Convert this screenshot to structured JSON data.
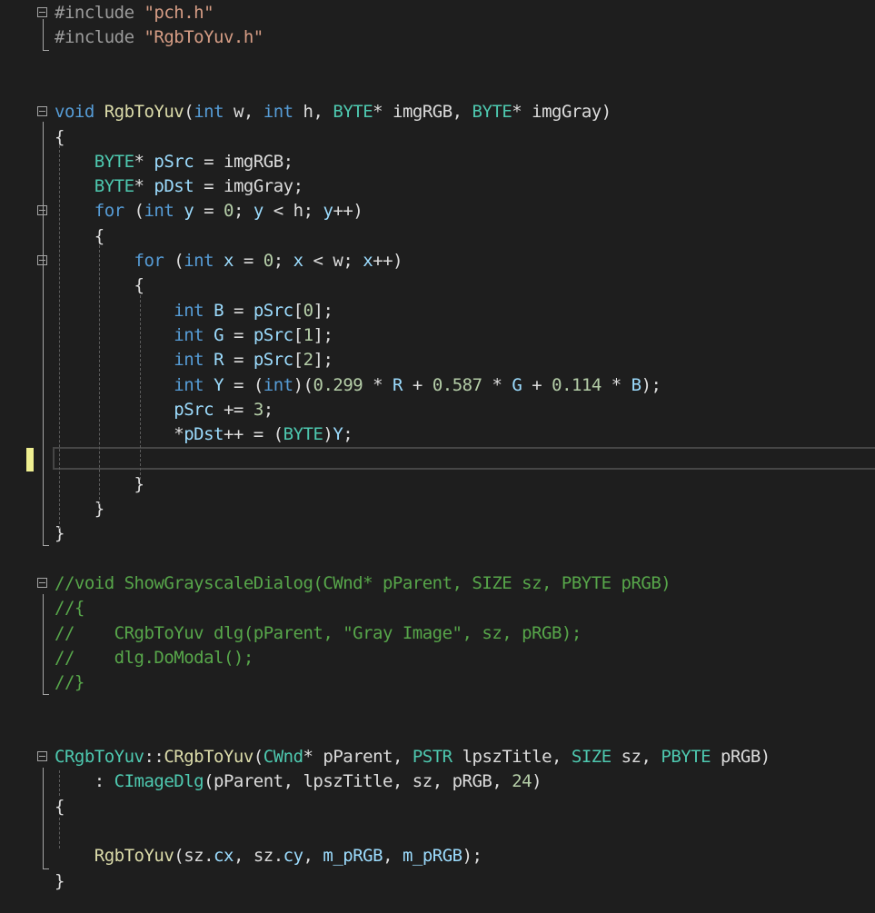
{
  "colors": {
    "background": "#1e1e1e",
    "keyword": "#569cd6",
    "type": "#4ec9b0",
    "string": "#d69d85",
    "comment": "#57a64a",
    "function": "#dcdcaa",
    "variable": "#9cdcfe",
    "number": "#b5cea8",
    "plain": "#dcdcdc",
    "preprocessor": "#9b9b9b",
    "changed_marker": "#efef91"
  },
  "code_lines": [
    {
      "row": 0,
      "tokens": [
        [
          "pp",
          "#include "
        ],
        [
          "str",
          "\"pch.h\""
        ]
      ]
    },
    {
      "row": 1,
      "tokens": [
        [
          "pp",
          "#include "
        ],
        [
          "str",
          "\"RgbToYuv.h\""
        ]
      ]
    },
    {
      "row": 2,
      "tokens": []
    },
    {
      "row": 3,
      "tokens": []
    },
    {
      "row": 4,
      "tokens": [
        [
          "kw",
          "void"
        ],
        [
          "p",
          " "
        ],
        [
          "fn",
          "RgbToYuv"
        ],
        [
          "p",
          "("
        ],
        [
          "kw",
          "int"
        ],
        [
          "p",
          " w, "
        ],
        [
          "kw",
          "int"
        ],
        [
          "p",
          " h, "
        ],
        [
          "ty",
          "BYTE"
        ],
        [
          "p",
          "* imgRGB, "
        ],
        [
          "ty",
          "BYTE"
        ],
        [
          "p",
          "* imgGray)"
        ]
      ]
    },
    {
      "row": 5,
      "tokens": [
        [
          "p",
          "{"
        ]
      ]
    },
    {
      "row": 6,
      "tokens": [
        [
          "p",
          "    "
        ],
        [
          "ty",
          "BYTE"
        ],
        [
          "p",
          "* "
        ],
        [
          "var",
          "pSrc"
        ],
        [
          "p",
          " = imgRGB;"
        ]
      ]
    },
    {
      "row": 7,
      "tokens": [
        [
          "p",
          "    "
        ],
        [
          "ty",
          "BYTE"
        ],
        [
          "p",
          "* "
        ],
        [
          "var",
          "pDst"
        ],
        [
          "p",
          " = imgGray;"
        ]
      ]
    },
    {
      "row": 8,
      "tokens": [
        [
          "p",
          "    "
        ],
        [
          "kw",
          "for"
        ],
        [
          "p",
          " ("
        ],
        [
          "kw",
          "int"
        ],
        [
          "p",
          " "
        ],
        [
          "var",
          "y"
        ],
        [
          "p",
          " = "
        ],
        [
          "num",
          "0"
        ],
        [
          "p",
          "; "
        ],
        [
          "var",
          "y"
        ],
        [
          "p",
          " < h; "
        ],
        [
          "var",
          "y"
        ],
        [
          "p",
          "++)"
        ]
      ]
    },
    {
      "row": 9,
      "tokens": [
        [
          "p",
          "    {"
        ]
      ]
    },
    {
      "row": 10,
      "tokens": [
        [
          "p",
          "        "
        ],
        [
          "kw",
          "for"
        ],
        [
          "p",
          " ("
        ],
        [
          "kw",
          "int"
        ],
        [
          "p",
          " "
        ],
        [
          "var",
          "x"
        ],
        [
          "p",
          " = "
        ],
        [
          "num",
          "0"
        ],
        [
          "p",
          "; "
        ],
        [
          "var",
          "x"
        ],
        [
          "p",
          " < w; "
        ],
        [
          "var",
          "x"
        ],
        [
          "p",
          "++)"
        ]
      ]
    },
    {
      "row": 11,
      "tokens": [
        [
          "p",
          "        {"
        ]
      ]
    },
    {
      "row": 12,
      "tokens": [
        [
          "p",
          "            "
        ],
        [
          "kw",
          "int"
        ],
        [
          "p",
          " "
        ],
        [
          "var",
          "B"
        ],
        [
          "p",
          " = "
        ],
        [
          "var",
          "pSrc"
        ],
        [
          "p",
          "["
        ],
        [
          "num",
          "0"
        ],
        [
          "p",
          "];"
        ]
      ]
    },
    {
      "row": 13,
      "tokens": [
        [
          "p",
          "            "
        ],
        [
          "kw",
          "int"
        ],
        [
          "p",
          " "
        ],
        [
          "var",
          "G"
        ],
        [
          "p",
          " = "
        ],
        [
          "var",
          "pSrc"
        ],
        [
          "p",
          "["
        ],
        [
          "num",
          "1"
        ],
        [
          "p",
          "];"
        ]
      ]
    },
    {
      "row": 14,
      "tokens": [
        [
          "p",
          "            "
        ],
        [
          "kw",
          "int"
        ],
        [
          "p",
          " "
        ],
        [
          "var",
          "R"
        ],
        [
          "p",
          " = "
        ],
        [
          "var",
          "pSrc"
        ],
        [
          "p",
          "["
        ],
        [
          "num",
          "2"
        ],
        [
          "p",
          "];"
        ]
      ]
    },
    {
      "row": 15,
      "tokens": [
        [
          "p",
          "            "
        ],
        [
          "kw",
          "int"
        ],
        [
          "p",
          " "
        ],
        [
          "var",
          "Y"
        ],
        [
          "p",
          " = ("
        ],
        [
          "kw",
          "int"
        ],
        [
          "p",
          ")("
        ],
        [
          "num",
          "0.299"
        ],
        [
          "p",
          " * "
        ],
        [
          "var",
          "R"
        ],
        [
          "p",
          " + "
        ],
        [
          "num",
          "0.587"
        ],
        [
          "p",
          " * "
        ],
        [
          "var",
          "G"
        ],
        [
          "p",
          " + "
        ],
        [
          "num",
          "0.114"
        ],
        [
          "p",
          " * "
        ],
        [
          "var",
          "B"
        ],
        [
          "p",
          ");"
        ]
      ]
    },
    {
      "row": 16,
      "tokens": [
        [
          "p",
          "            "
        ],
        [
          "var",
          "pSrc"
        ],
        [
          "p",
          " += "
        ],
        [
          "num",
          "3"
        ],
        [
          "p",
          ";"
        ]
      ]
    },
    {
      "row": 17,
      "tokens": [
        [
          "p",
          "            *"
        ],
        [
          "var",
          "pDst"
        ],
        [
          "p",
          "++ = ("
        ],
        [
          "ty",
          "BYTE"
        ],
        [
          "p",
          ")"
        ],
        [
          "var",
          "Y"
        ],
        [
          "p",
          ";"
        ]
      ]
    },
    {
      "row": 18,
      "tokens": []
    },
    {
      "row": 19,
      "tokens": [
        [
          "p",
          "        }"
        ]
      ]
    },
    {
      "row": 20,
      "tokens": [
        [
          "p",
          "    }"
        ]
      ]
    },
    {
      "row": 21,
      "tokens": [
        [
          "p",
          "}"
        ]
      ]
    },
    {
      "row": 22,
      "tokens": []
    },
    {
      "row": 23,
      "tokens": [
        [
          "cm",
          "//void ShowGrayscaleDialog(CWnd* pParent, SIZE sz, PBYTE pRGB)"
        ]
      ]
    },
    {
      "row": 24,
      "tokens": [
        [
          "cm",
          "//{"
        ]
      ]
    },
    {
      "row": 25,
      "tokens": [
        [
          "cm",
          "//    CRgbToYuv dlg(pParent, \"Gray Image\", sz, pRGB);"
        ]
      ]
    },
    {
      "row": 26,
      "tokens": [
        [
          "cm",
          "//    dlg.DoModal();"
        ]
      ]
    },
    {
      "row": 27,
      "tokens": [
        [
          "cm",
          "//}"
        ]
      ]
    },
    {
      "row": 28,
      "tokens": []
    },
    {
      "row": 29,
      "tokens": []
    },
    {
      "row": 30,
      "tokens": [
        [
          "ty",
          "CRgbToYuv"
        ],
        [
          "p",
          "::"
        ],
        [
          "fn",
          "CRgbToYuv"
        ],
        [
          "p",
          "("
        ],
        [
          "ty",
          "CWnd"
        ],
        [
          "p",
          "* pParent, "
        ],
        [
          "ty",
          "PSTR"
        ],
        [
          "p",
          " lpszTitle, "
        ],
        [
          "ty",
          "SIZE"
        ],
        [
          "p",
          " sz, "
        ],
        [
          "ty",
          "PBYTE"
        ],
        [
          "p",
          " pRGB)"
        ]
      ]
    },
    {
      "row": 31,
      "tokens": [
        [
          "p",
          "    : "
        ],
        [
          "ty",
          "CImageDlg"
        ],
        [
          "p",
          "(pParent, lpszTitle, sz, pRGB, "
        ],
        [
          "num",
          "24"
        ],
        [
          "p",
          ")"
        ]
      ]
    },
    {
      "row": 32,
      "tokens": [
        [
          "p",
          "{"
        ]
      ]
    },
    {
      "row": 33,
      "tokens": []
    },
    {
      "row": 34,
      "tokens": [
        [
          "p",
          "    "
        ],
        [
          "fn",
          "RgbToYuv"
        ],
        [
          "p",
          "(sz."
        ],
        [
          "var",
          "cx"
        ],
        [
          "p",
          ", sz."
        ],
        [
          "var",
          "cy"
        ],
        [
          "p",
          ", "
        ],
        [
          "var",
          "m_pRGB"
        ],
        [
          "p",
          ", "
        ],
        [
          "var",
          "m_pRGB"
        ],
        [
          "p",
          ");"
        ]
      ]
    },
    {
      "row": 35,
      "tokens": [
        [
          "p",
          "}"
        ]
      ]
    }
  ],
  "fold_rows": [
    0,
    4,
    8,
    10,
    23,
    30
  ]
}
